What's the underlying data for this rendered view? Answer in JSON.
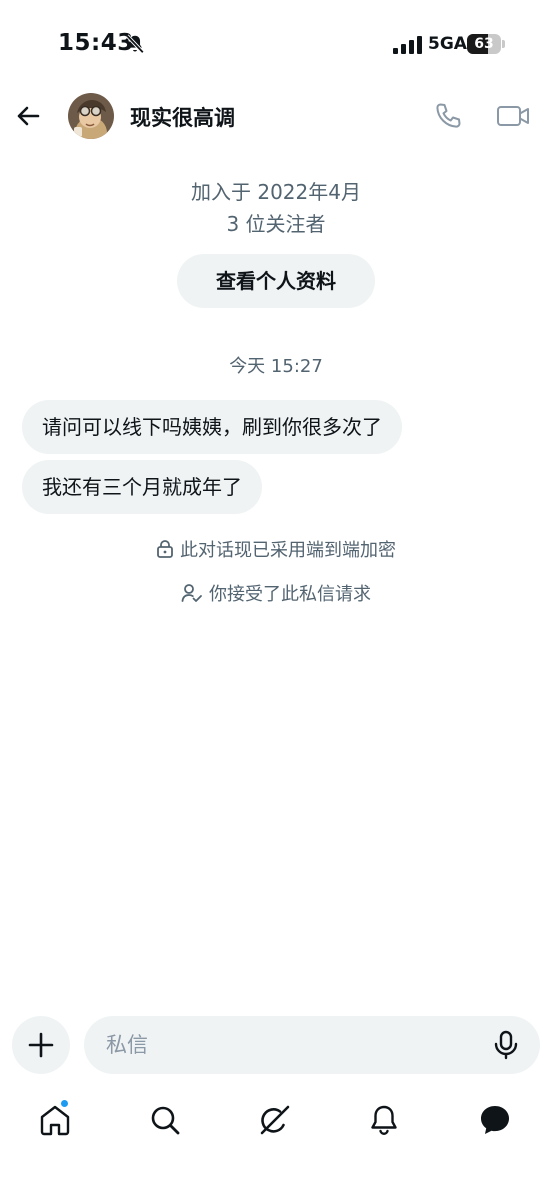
{
  "status_bar": {
    "time": "15:43",
    "network": "5GA",
    "battery_level": "63",
    "battery_fraction": 0.63
  },
  "header": {
    "contact_name": "现实很高调"
  },
  "profile": {
    "joined": "加入于 2022年4月",
    "followers": "3 位关注者",
    "view_profile_label": "查看个人资料"
  },
  "conversation": {
    "timestamp": "今天 15:27",
    "messages": [
      {
        "text": "请问可以线下吗姨姨，刷到你很多次了"
      },
      {
        "text": "我还有三个月就成年了"
      }
    ],
    "encryption_notice": "此对话现已采用端到端加密",
    "accepted_notice": "你接受了此私信请求"
  },
  "composer": {
    "placeholder": "私信"
  },
  "colors": {
    "accent": "#1d9bf0",
    "bubble": "#eff3f4",
    "secondary_text": "#536471"
  },
  "icons": [
    "muted-bell-icon",
    "signal-bars-icon",
    "battery-icon",
    "back-arrow-icon",
    "phone-icon",
    "video-call-icon",
    "lock-icon",
    "person-check-icon",
    "plus-icon",
    "microphone-icon",
    "home-icon",
    "search-icon",
    "grok-icon",
    "bell-icon",
    "messages-icon"
  ]
}
